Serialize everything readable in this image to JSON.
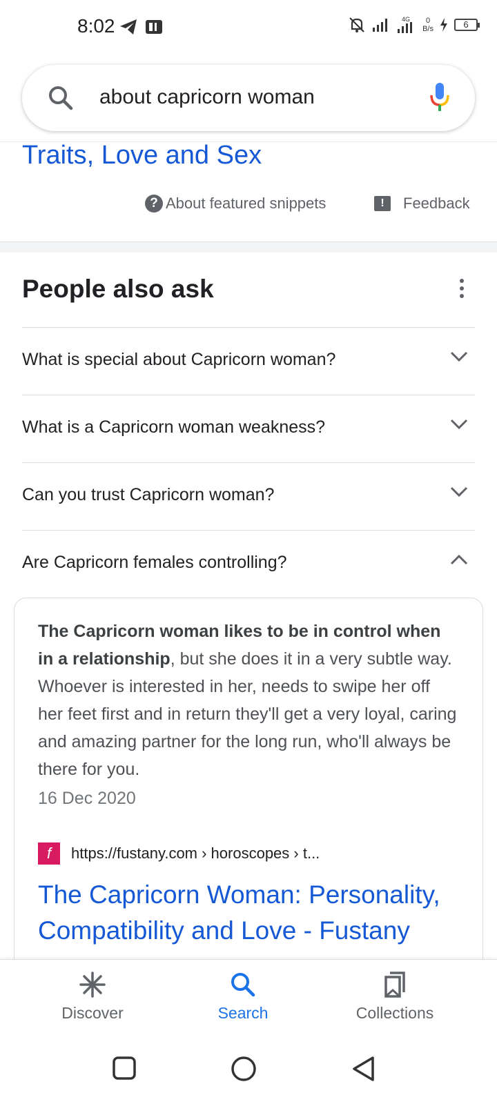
{
  "status_bar": {
    "time": "8:02",
    "net_speed_value": "0",
    "net_speed_unit": "B/s",
    "network_type": "4G",
    "battery_level": "6"
  },
  "search": {
    "query": "about capricorn woman"
  },
  "snippet": {
    "title_tail": "Traits, Love and Sex",
    "about_label": "About featured snippets",
    "feedback_label": "Feedback"
  },
  "people_also_ask": {
    "title": "People also ask",
    "questions": [
      {
        "text": "What is special about Capricorn woman?",
        "expanded": false
      },
      {
        "text": "What is a Capricorn woman weakness?",
        "expanded": false
      },
      {
        "text": "Can you trust Capricorn woman?",
        "expanded": false
      },
      {
        "text": "Are Capricorn females controlling?",
        "expanded": true
      }
    ],
    "answer": {
      "bold": "The Capricorn woman likes to be in control when in a relationship",
      "rest": ", but she does it in a very subtle way. Whoever is interested in her, needs to swipe her off her feet first and in return they'll get a very loyal, caring and amazing partner for the long run, who'll always be there for you.",
      "date": "16 Dec 2020",
      "source_url": "https://fustany.com › horoscopes › t...",
      "result_title": "The Capricorn Woman: Personality, Compatibility and Love - Fustany"
    }
  },
  "bottom_nav": {
    "items": [
      {
        "label": "Discover",
        "icon": "asterisk-icon",
        "active": false
      },
      {
        "label": "Search",
        "icon": "search-icon",
        "active": true
      },
      {
        "label": "Collections",
        "icon": "collections-icon",
        "active": false
      }
    ]
  },
  "colors": {
    "link": "#1558d6",
    "active_nav": "#1a73e8",
    "favicon": "#d81b60"
  }
}
